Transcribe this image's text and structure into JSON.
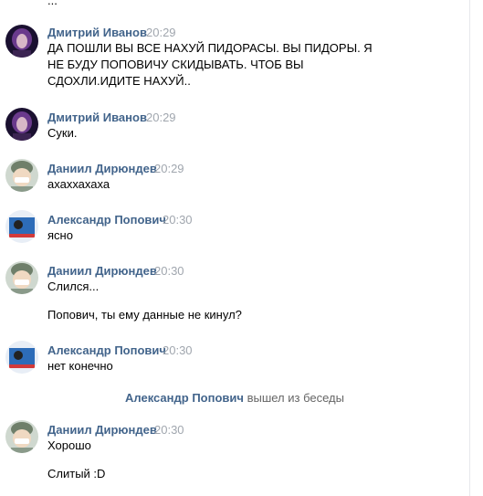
{
  "top_stub": "...",
  "messages": [
    {
      "author": "Дмитрий Иванов",
      "time": "20:29",
      "text": "ДА ПОШЛИ ВЫ ВСЕ НАХУЙ ПИДОРАСЫ. ВЫ ПИДОРЫ. Я НЕ БУДУ ПОПОВИЧУ СКИДЫВАТЬ. ЧТОБ ВЫ СДОХЛИ.ИДИТЕ НАХУЙ.."
    },
    {
      "author": "Дмитрий Иванов",
      "time": "20:29",
      "text": "Суки."
    },
    {
      "author": "Даниил Дирюндев",
      "time": "20:29",
      "text": "ахаххахаха"
    },
    {
      "author": "Александр Попович",
      "time": "20:30",
      "text": "ясно"
    },
    {
      "author": "Даниил Дирюндев",
      "time": "20:30",
      "text": "Слился..."
    },
    {
      "author": "",
      "time": "",
      "text": "Попович, ты ему данные не кинул?"
    },
    {
      "author": "Александр Попович",
      "time": "20:30",
      "text": "нет конечно"
    },
    {
      "author": "Даниил Дирюндев",
      "time": "20:30",
      "text": "Хорошо"
    },
    {
      "author": "",
      "time": "",
      "text": "Слитый :D"
    }
  ],
  "service_message": {
    "actor": "Александр Попович",
    "action": "вышел из беседы"
  },
  "colors": {
    "author": "#42648b",
    "time": "#a0a6ae",
    "service": "#656565"
  },
  "avatars": {
    "dmitry": "avatar-purple-portrait",
    "daniil": "avatar-cartoon-face",
    "alexander": "avatar-blue-screen"
  }
}
